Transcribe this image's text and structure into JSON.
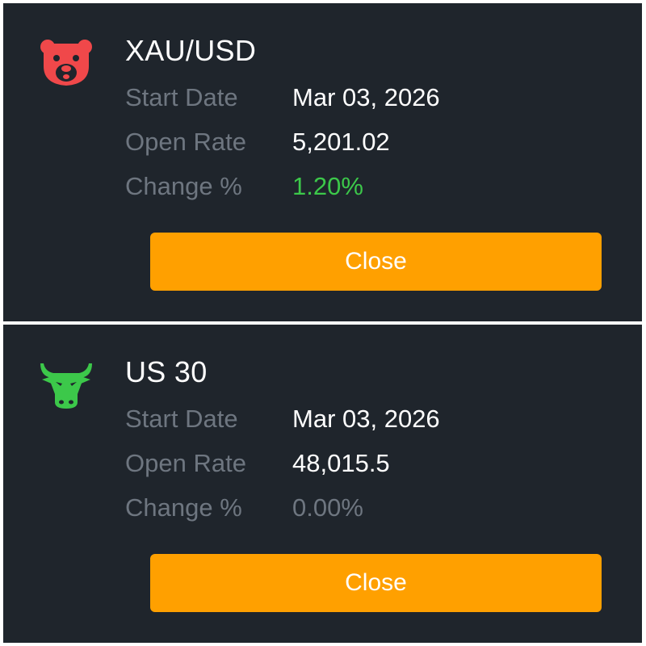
{
  "cards": [
    {
      "icon": "bear-icon",
      "icon_color": "#f0484a",
      "title": "XAU/USD",
      "rows": [
        {
          "label": "Start Date",
          "value": "Mar 03, 2026"
        },
        {
          "label": "Open Rate",
          "value": "5,201.02"
        },
        {
          "label": "Change %",
          "value": "1.20%",
          "value_color": "#3cc84a"
        }
      ],
      "button_label": "Close"
    },
    {
      "icon": "bull-icon",
      "icon_color": "#3cc84a",
      "title": "US 30",
      "rows": [
        {
          "label": "Start Date",
          "value": "Mar 03, 2026"
        },
        {
          "label": "Open Rate",
          "value": "48,015.5"
        },
        {
          "label": "Change %",
          "value": "0.00%",
          "value_color": "#6e7680"
        }
      ],
      "button_label": "Close"
    }
  ],
  "colors": {
    "card_background": "#1f252c",
    "label_text": "#6e7680",
    "value_text": "#ffffff",
    "button_background": "#ffa000",
    "button_text": "#ffffff"
  }
}
